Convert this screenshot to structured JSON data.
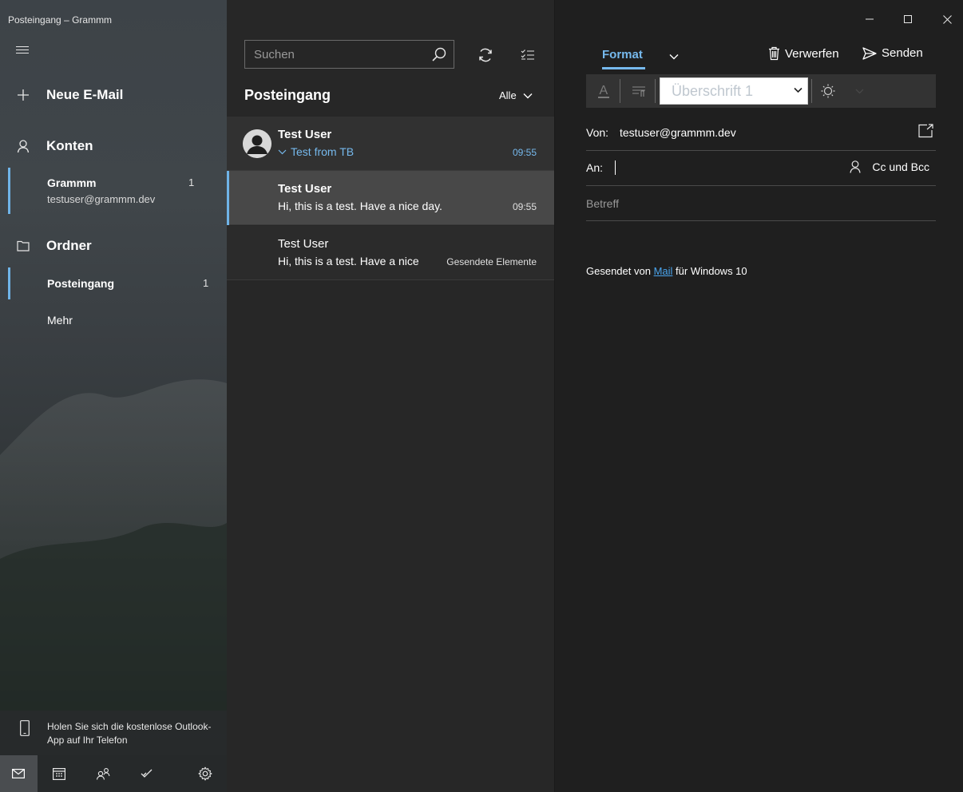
{
  "window": {
    "title": "Posteingang – Grammm"
  },
  "sidebar": {
    "new_mail": "Neue E-Mail",
    "accounts_label": "Konten",
    "account": {
      "name": "Grammm",
      "email": "testuser@grammm.dev",
      "count": "1"
    },
    "folders_label": "Ordner",
    "folders": [
      {
        "label": "Posteingang",
        "count": "1"
      },
      {
        "label": "Mehr",
        "count": ""
      }
    ],
    "promo_text": "Holen Sie sich die kostenlose Outlook-App auf Ihr Telefon",
    "bottom_icons": [
      "mail-icon",
      "calendar-icon",
      "people-icon",
      "todo-icon",
      "settings-icon"
    ]
  },
  "list": {
    "search_placeholder": "Suchen",
    "title": "Posteingang",
    "filter_label": "Alle",
    "messages": [
      {
        "sender": "Test User",
        "subject": "Test from TB",
        "time": "09:55"
      },
      {
        "sender": "Test User",
        "preview": "Hi, this is a test. Have a nice day.",
        "time": "09:55"
      },
      {
        "sender": "Test User",
        "preview": "Hi, this is a test. Have a nice",
        "folder": "Gesendete Elemente"
      }
    ]
  },
  "compose": {
    "tab_format": "Format",
    "discard_label": "Verwerfen",
    "send_label": "Senden",
    "heading_style": "Überschrift 1",
    "from_label": "Von:",
    "from_value": "testuser@grammm.dev",
    "to_label": "An:",
    "cc_bcc_label": "Cc und Bcc",
    "subject_placeholder": "Betreff",
    "signature_prefix": "Gesendet von",
    "signature_link": "Mail",
    "signature_suffix": "für Windows 10"
  },
  "colors": {
    "accent": "#76b9ed",
    "link": "#4aa5ee",
    "selection_bar": "#6fb4e8",
    "list_bg": "#272727",
    "compose_bg": "#1f1f1f"
  }
}
